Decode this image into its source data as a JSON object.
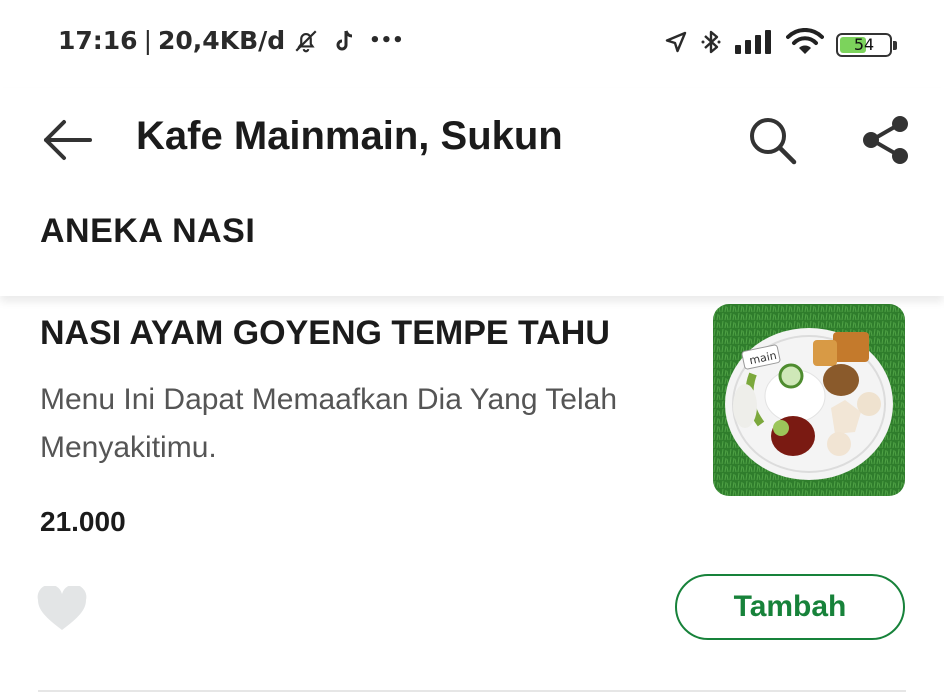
{
  "status_bar": {
    "time": "17:16",
    "separator": "|",
    "net_speed": "20,4KB/d",
    "more": "•••",
    "battery_level": "54",
    "battery_fraction": 0.54,
    "icons": [
      "bell-off-icon",
      "tiktok-icon",
      "location-arrow-icon",
      "bluetooth-icon",
      "signal-icon",
      "wifi-icon",
      "battery-icon"
    ],
    "battery_color": "#7cd35c"
  },
  "header": {
    "title": "Kafe Mainmain, Sukun",
    "back_icon": "arrow-left-icon",
    "search_icon": "search-icon",
    "share_icon": "share-icon"
  },
  "section": {
    "title": "ANEKA NASI"
  },
  "menu_item": {
    "name": "NASI AYAM GOYENG TEMPE TAHU",
    "description": "Menu Ini Dapat Memaafkan Dia Yang Telah Menyakitimu.",
    "price": "21.000",
    "image_label": "main",
    "favorite_icon": "heart-icon",
    "add_label": "Tambah",
    "accent_color": "#17823a"
  }
}
